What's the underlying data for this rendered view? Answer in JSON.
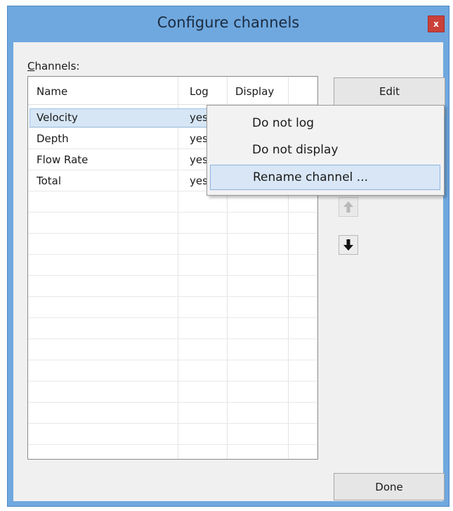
{
  "window": {
    "title": "Configure channels",
    "close_label": "x"
  },
  "channels_label": {
    "underlined_letter": "C",
    "rest": "hannels:"
  },
  "table": {
    "headers": {
      "name": "Name",
      "log": "Log",
      "display": "Display"
    },
    "rows": [
      {
        "name": "Velocity",
        "log": "yes"
      },
      {
        "name": "Depth",
        "log": "yes"
      },
      {
        "name": "Flow Rate",
        "log": "yes"
      },
      {
        "name": "Total",
        "log": "yes"
      }
    ]
  },
  "buttons": {
    "edit": "Edit",
    "done": "Done"
  },
  "context_menu": {
    "items": [
      "Do not log",
      "Do not display",
      "Rename channel ..."
    ],
    "highlighted_index": 2
  },
  "colors": {
    "window_frame": "#6fa8df",
    "close_button": "#c9413a",
    "selection": "#d6e6f5",
    "menu_highlight": "#d8e6f6"
  },
  "icons": [
    "close-icon",
    "arrow-up-icon",
    "arrow-down-icon"
  ]
}
